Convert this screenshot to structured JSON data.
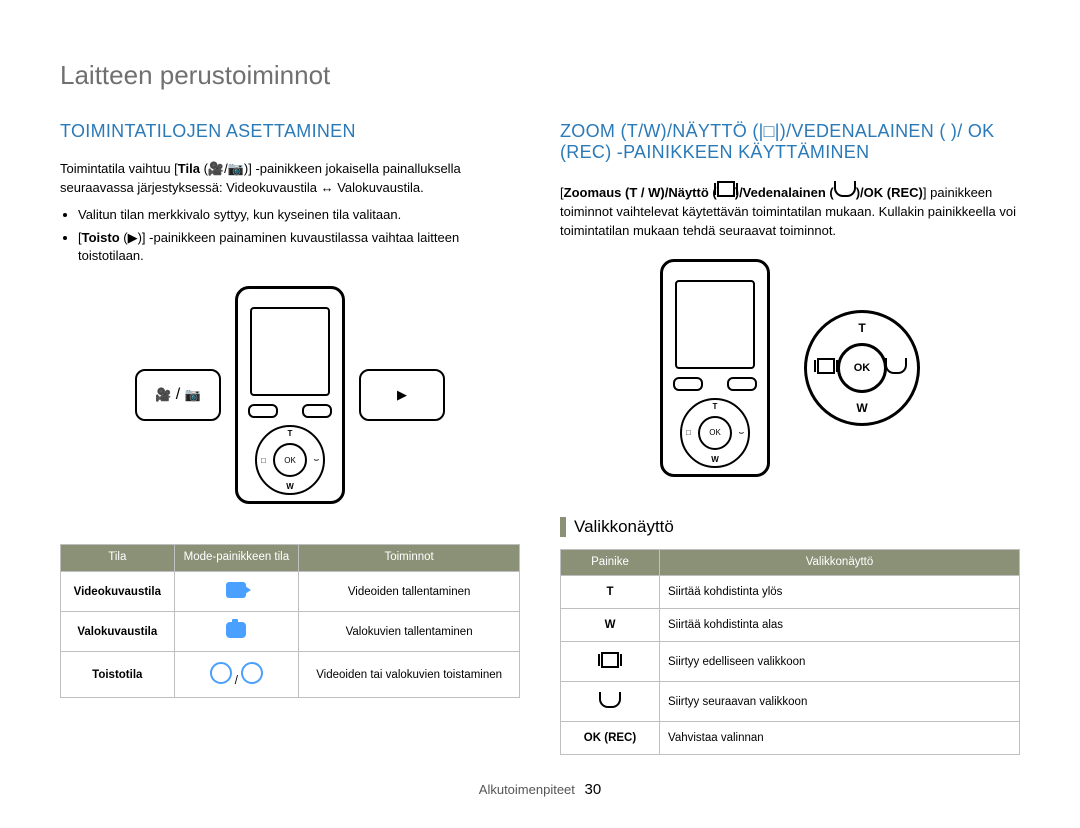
{
  "chapter_title": "Laitteen perustoiminnot",
  "left": {
    "heading": "TOIMINTATILOJEN ASETTAMINEN",
    "para1_a": "Toimintatila vaihtuu [",
    "para1_b": "Tila",
    "para1_c": " (",
    "para1_d": "/",
    "para1_e": ")] -painikkeen jokaisella painalluksella seuraavassa järjestyksessä: Videokuvaustila ↔ Valokuvaustila.",
    "bullet1": "Valitun tilan merkkivalo syttyy, kun kyseinen tila valitaan.",
    "bullet2_a": "[",
    "bullet2_b": "Toisto",
    "bullet2_c": " (▶)] -painikkeen painaminen kuvaustilassa vaihtaa laitteen toistotilaan.",
    "table": {
      "headers": {
        "h1": "Tila",
        "h2": "Mode-painikkeen tila",
        "h3": "Toiminnot"
      },
      "rows": [
        {
          "c1": "Videokuvaustila",
          "c2_icon": "video",
          "c3": "Videoiden tallentaminen"
        },
        {
          "c1": "Valokuvaustila",
          "c2_icon": "photo",
          "c3": "Valokuvien tallentaminen"
        },
        {
          "c1": "Toistotila",
          "c2_icon": "play",
          "c3": "Videoiden tai valokuvien toistaminen"
        }
      ]
    }
  },
  "right": {
    "heading": "ZOOM (T/W)/NÄYTTÖ (|□|)/VEDENALAINEN (  )/ OK (REC) -PAINIKKEEN KÄYTTÄMINEN",
    "para_a": "[",
    "para_b": "Zoomaus (T / W)/Näyttö (",
    "para_c": ")/Vedenalainen (",
    "para_d": ")/OK (REC)",
    "para_e": "] painikkeen toiminnot vaihtelevat käytettävän toimintatilan mukaan. Kullakin painikkeella voi toimintatilan mukaan tehdä seuraavat toiminnot.",
    "nav": {
      "t": "T",
      "w": "W",
      "ok": "OK"
    },
    "subheading": "Valikkonäyttö",
    "table": {
      "headers": {
        "h1": "Painike",
        "h2": "Valikkonäyttö"
      },
      "rows": [
        {
          "c1": "T",
          "c2": "Siirtää kohdistinta ylös"
        },
        {
          "c1": "W",
          "c2": "Siirtää kohdistinta alas"
        },
        {
          "c1": "disp",
          "c2": "Siirtyy edelliseen valikkoon"
        },
        {
          "c1": "uw",
          "c2": "Siirtyy seuraavan valikkoon"
        },
        {
          "c1": "OK (REC)",
          "c2": "Vahvistaa valinnan"
        }
      ]
    }
  },
  "footer": {
    "section": "Alkutoimenpiteet",
    "page": "30"
  }
}
